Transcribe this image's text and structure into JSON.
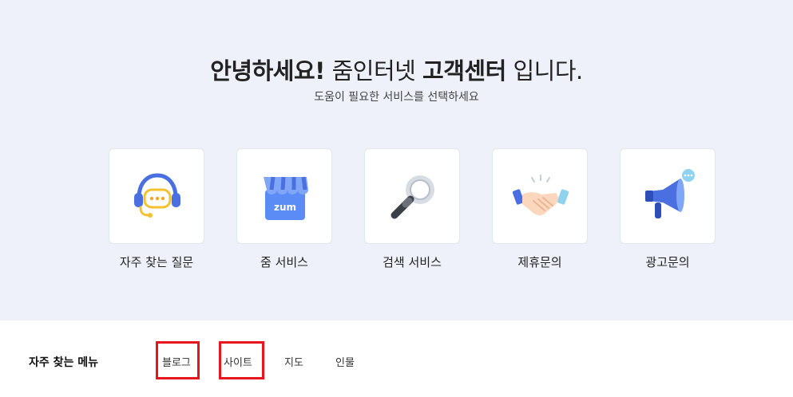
{
  "hero": {
    "title_bold_1": "안녕하세요!",
    "title_normal_1": " 줌인터넷 ",
    "title_bold_2": "고객센터",
    "title_normal_2": " 입니다.",
    "subtitle": "도움이 필요한 서비스를 선택하세요"
  },
  "cards": [
    {
      "label": "자주 찾는 질문",
      "icon": "headset-icon"
    },
    {
      "label": "줌 서비스",
      "icon": "zum-store-icon",
      "icon_text": "zum"
    },
    {
      "label": "검색 서비스",
      "icon": "magnifier-icon"
    },
    {
      "label": "제휴문의",
      "icon": "handshake-icon"
    },
    {
      "label": "광고문의",
      "icon": "megaphone-icon"
    }
  ],
  "menu": {
    "title": "자주 찾는 메뉴",
    "links": [
      "블로그",
      "사이트",
      "지도",
      "인물"
    ]
  },
  "colors": {
    "hero_bg": "#eef1f9",
    "accent_blue": "#4a6fe0",
    "highlight_red": "#e8161c"
  }
}
